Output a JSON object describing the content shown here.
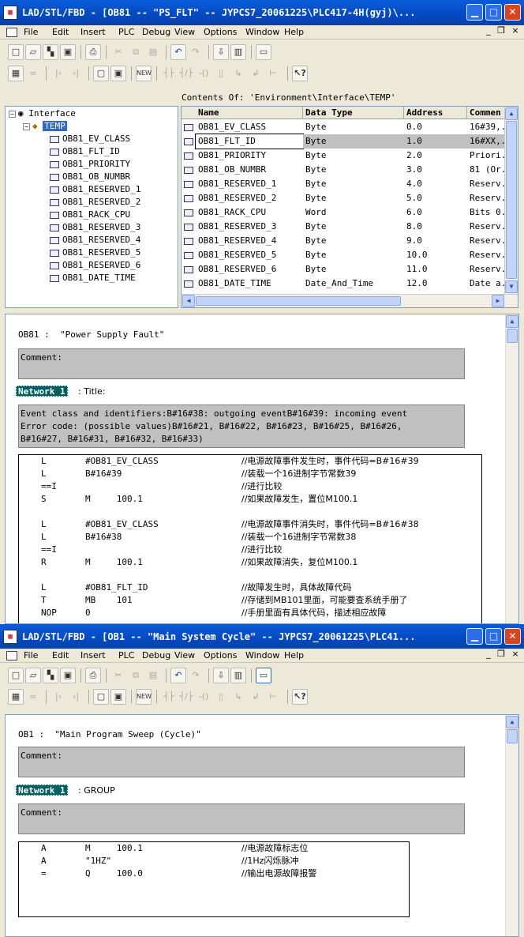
{
  "window1": {
    "title": "LAD/STL/FBD  - [OB81 -- \"PS_FLT\" -- JYPCS7_20061225\\PLC417-4H(gyj)\\...",
    "menu": [
      "File",
      "Edit",
      "Insert",
      "PLC",
      "Debug",
      "View",
      "Options",
      "Window",
      "Help"
    ],
    "contents_of": "Contents Of: 'Environment\\Interface\\TEMP'",
    "tree": {
      "root": "Interface",
      "temp": "TEMP",
      "items": [
        "OB81_EV_CLASS",
        "OB81_FLT_ID",
        "OB81_PRIORITY",
        "OB81_OB_NUMBR",
        "OB81_RESERVED_1",
        "OB81_RESERVED_2",
        "OB81_RACK_CPU",
        "OB81_RESERVED_3",
        "OB81_RESERVED_4",
        "OB81_RESERVED_5",
        "OB81_RESERVED_6",
        "OB81_DATE_TIME"
      ]
    },
    "table": {
      "headers": [
        "Name",
        "Data Type",
        "Address",
        "Commen"
      ],
      "rows": [
        {
          "name": "OB81_EV_CLASS",
          "type": "Byte",
          "address": "0.0",
          "comment": "16#39,."
        },
        {
          "name": "OB81_FLT_ID",
          "type": "Byte",
          "address": "1.0",
          "comment": "16#XX,."
        },
        {
          "name": "OB81_PRIORITY",
          "type": "Byte",
          "address": "2.0",
          "comment": "Priori."
        },
        {
          "name": "OB81_OB_NUMBR",
          "type": "Byte",
          "address": "3.0",
          "comment": "81 (Or."
        },
        {
          "name": "OB81_RESERVED_1",
          "type": "Byte",
          "address": "4.0",
          "comment": "Reserv."
        },
        {
          "name": "OB81_RESERVED_2",
          "type": "Byte",
          "address": "5.0",
          "comment": "Reserv."
        },
        {
          "name": "OB81_RACK_CPU",
          "type": "Word",
          "address": "6.0",
          "comment": "Bits 0."
        },
        {
          "name": "OB81_RESERVED_3",
          "type": "Byte",
          "address": "8.0",
          "comment": "Reserv."
        },
        {
          "name": "OB81_RESERVED_4",
          "type": "Byte",
          "address": "9.0",
          "comment": "Reserv."
        },
        {
          "name": "OB81_RESERVED_5",
          "type": "Byte",
          "address": "10.0",
          "comment": "Reserv."
        },
        {
          "name": "OB81_RESERVED_6",
          "type": "Byte",
          "address": "11.0",
          "comment": "Reserv."
        },
        {
          "name": "OB81_DATE_TIME",
          "type": "Date_And_Time",
          "address": "12.0",
          "comment": "Date a."
        }
      ]
    },
    "block_title": "OB81 :  \"Power Supply Fault\"",
    "comment_label": "Comment:",
    "network_label": "Network 1",
    "network_title": ": Title:",
    "network_comment": "Event class and identifiers:B#16#38: outgoing eventB#16#39: incoming event\nError code: (possible values)B#16#21, B#16#22, B#16#23, B#16#25, B#16#26,\nB#16#27, B#16#31, B#16#32, B#16#33)",
    "stl": [
      {
        "op": "L",
        "arg": "#OB81_EV_CLASS",
        "cm": "//电源故障事件发生时，事件代码=B#16#39"
      },
      {
        "op": "L",
        "arg": "B#16#39",
        "cm": "//装载一个16进制字节常数39"
      },
      {
        "op": "==I",
        "arg": "",
        "cm": "//进行比较"
      },
      {
        "op": "S",
        "arg": "M     100.1",
        "cm": "//如果故障发生，置位M100.1"
      },
      {
        "op": "",
        "arg": "",
        "cm": ""
      },
      {
        "op": "L",
        "arg": "#OB81_EV_CLASS",
        "cm": "//电源故障事件消失时，事件代码=B#16#38"
      },
      {
        "op": "L",
        "arg": "B#16#38",
        "cm": "//装载一个16进制字节常数38"
      },
      {
        "op": "==I",
        "arg": "",
        "cm": "//进行比较"
      },
      {
        "op": "R",
        "arg": "M     100.1",
        "cm": "//如果故障消失，复位M100.1"
      },
      {
        "op": "",
        "arg": "",
        "cm": ""
      },
      {
        "op": "L",
        "arg": "#OB81_FLT_ID",
        "cm": "//故障发生时，具体故障代码"
      },
      {
        "op": "T",
        "arg": "MB    101",
        "cm": "//存储到MB101里面，可能要查系统手册了"
      },
      {
        "op": "NOP",
        "arg": "0",
        "cm": "//手册里面有具体代码，描述相应故障"
      }
    ]
  },
  "window2": {
    "title": "LAD/STL/FBD  - [OB1 -- \"Main System Cycle\" -- JYPCS7_20061225\\PLC41...",
    "menu": [
      "File",
      "Edit",
      "Insert",
      "PLC",
      "Debug",
      "View",
      "Options",
      "Window",
      "Help"
    ],
    "block_title": "OB1 :  \"Main Program Sweep (Cycle)\"",
    "comment_label": "Comment:",
    "network_label": "Network 1",
    "network_title": ": GROUP",
    "network_comment": "Comment:",
    "stl": [
      {
        "op": "A",
        "arg": "M     100.1",
        "cm": "//电源故障标志位"
      },
      {
        "op": "A",
        "arg": "\"1HZ\"",
        "cm": "//1Hz闪烁脉冲"
      },
      {
        "op": "=",
        "arg": "Q     100.0",
        "cm": "//输出电源故障报警"
      }
    ]
  },
  "icons": {
    "title_controls": [
      "minimize-icon",
      "maximize-icon",
      "close-icon"
    ],
    "toolbar1": [
      "new-icon",
      "open-icon",
      "accessible-nodes-icon",
      "save-icon",
      "print-icon",
      "cut-icon",
      "copy-icon",
      "paste-icon",
      "undo-icon",
      "redo-icon",
      "download-icon",
      "monitor-icon",
      "comment-toggle-icon"
    ],
    "toolbar2": [
      "online-icon",
      "offline-icon",
      "prev-network-icon",
      "next-network-icon",
      "overview-icon",
      "symbol-table-icon",
      "new-network-icon",
      "contact-no-icon",
      "contact-nc-icon",
      "coil-icon",
      "empty-box-icon",
      "branch-open-icon",
      "branch-close-icon",
      "connection-icon",
      "help-icon"
    ]
  }
}
